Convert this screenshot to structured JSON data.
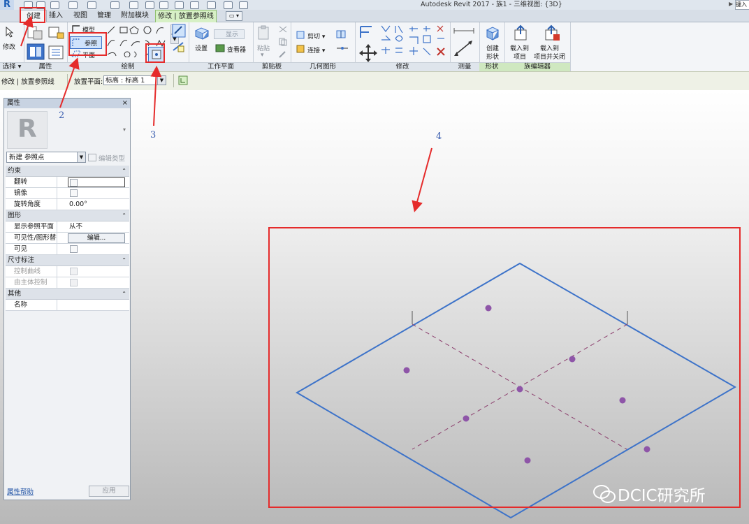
{
  "window": {
    "title": "Autodesk Revit 2017 -    族1 - 三维视图: {3D}",
    "app_logo": "R",
    "search_placeholder": "键入"
  },
  "tabs": [
    {
      "label": "创建",
      "active": true
    },
    {
      "label": "插入"
    },
    {
      "label": "视图"
    },
    {
      "label": "管理"
    },
    {
      "label": "附加模块"
    },
    {
      "label": "修改 | 放置参照线",
      "contextual": true
    }
  ],
  "ribbon": {
    "select_panel": {
      "modify_label": "修改",
      "panel_label": "选择"
    },
    "properties_panel": {
      "panel_label": "属性"
    },
    "draw_panel": {
      "model_label": "模型",
      "reference_label": "参照",
      "plane_label": "平面",
      "panel_label": "绘制"
    },
    "workplane_panel": {
      "set_label": "设置",
      "show_label": "显示",
      "viewer_label": "查看器",
      "panel_label": "工作平面"
    },
    "clipboard_panel": {
      "paste_label": "粘贴",
      "panel_label": "剪贴板"
    },
    "geometry_panel": {
      "cut_label": "剪切",
      "join_label": "连接",
      "panel_label": "几何图形"
    },
    "modify_panel": {
      "panel_label": "修改"
    },
    "measure_panel": {
      "panel_label": "测量"
    },
    "form_panel": {
      "create_line1": "创建",
      "create_line2": "形状",
      "panel_label": "形状"
    },
    "family_editor_panel": {
      "load_line1": "载入到",
      "load_line2": "项目",
      "load_close_line1": "载入到",
      "load_close_line2": "项目并关闭",
      "panel_label": "族编辑器"
    }
  },
  "options_bar": {
    "context": "修改 | 放置参照线",
    "placement_label": "放置平面:",
    "placement_value": "标高 : 标高 1"
  },
  "properties": {
    "title": "属性",
    "close": "×",
    "type_selector": "新建 参照点",
    "edit_type": "编辑类型",
    "categories": [
      {
        "name": "约束",
        "rows": [
          {
            "key": "翻转",
            "kind": "checkbox-field"
          },
          {
            "key": "镜像",
            "kind": "checkbox"
          },
          {
            "key": "旋转角度",
            "value": "0.00°"
          }
        ]
      },
      {
        "name": "图形",
        "rows": [
          {
            "key": "显示参照平面",
            "value": "从不"
          },
          {
            "key": "可见性/图形替换",
            "button": "编辑..."
          },
          {
            "key": "可见",
            "kind": "checkbox"
          }
        ]
      },
      {
        "name": "尺寸标注",
        "rows": [
          {
            "key": "控制曲线",
            "kind": "checkbox",
            "disabled": true
          },
          {
            "key": "由主体控制",
            "kind": "checkbox",
            "disabled": true
          }
        ]
      },
      {
        "name": "其他",
        "rows": [
          {
            "key": "名称",
            "value": ""
          }
        ]
      }
    ],
    "help_link": "属性帮助",
    "apply_button": "应用"
  },
  "annotations": {
    "callout_2": "2",
    "callout_3": "3",
    "callout_4": "4",
    "annotation_color": "#e52b2b"
  },
  "viewport": {
    "plane_edge_color": "#3d73c9",
    "reference_point_color": "#8e55a8",
    "reference_point_count": 9
  },
  "watermark": "DCIC研究所"
}
